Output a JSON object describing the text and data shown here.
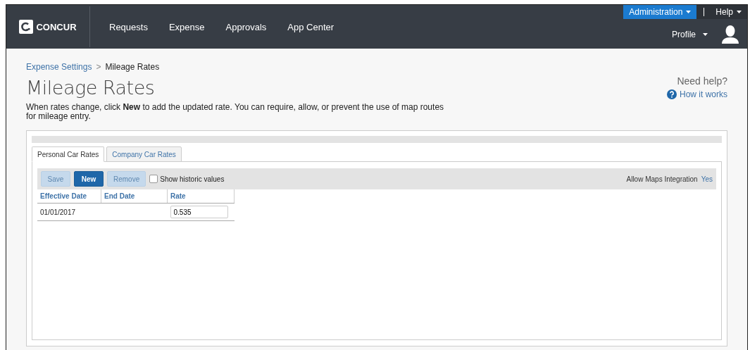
{
  "header": {
    "logo": "CONCUR",
    "nav": [
      "Requests",
      "Expense",
      "Approvals",
      "App Center"
    ],
    "admin": "Administration",
    "help": "Help",
    "profile": "Profile"
  },
  "breadcrumb": {
    "parent": "Expense Settings",
    "separator": ">",
    "current": "Mileage Rates"
  },
  "title": "Mileage Rates",
  "description": "When rates change, click **New** to add the updated rate. You can require, allow, or prevent the use of map routes for mileage entry.",
  "help": {
    "heading": "Need help?",
    "link": "How it works"
  },
  "tabs": [
    {
      "label": "Personal Car Rates",
      "selected": true
    },
    {
      "label": "Company Car Rates",
      "selected": false
    }
  ],
  "toolbar": {
    "buttons": [
      {
        "label": "Save",
        "disabled": true
      },
      {
        "label": "New",
        "disabled": false
      },
      {
        "label": "Remove",
        "disabled": true
      }
    ],
    "show_historic": {
      "label": "Show historic values",
      "checked": false
    },
    "maps_label": "Allow Maps Integration",
    "maps_value": "Yes"
  },
  "table": {
    "columns": [
      "Effective Date",
      "End Date",
      "Rate"
    ],
    "rows": [
      {
        "effective_date": "01/01/2017",
        "rate": "0.535"
      }
    ]
  }
}
